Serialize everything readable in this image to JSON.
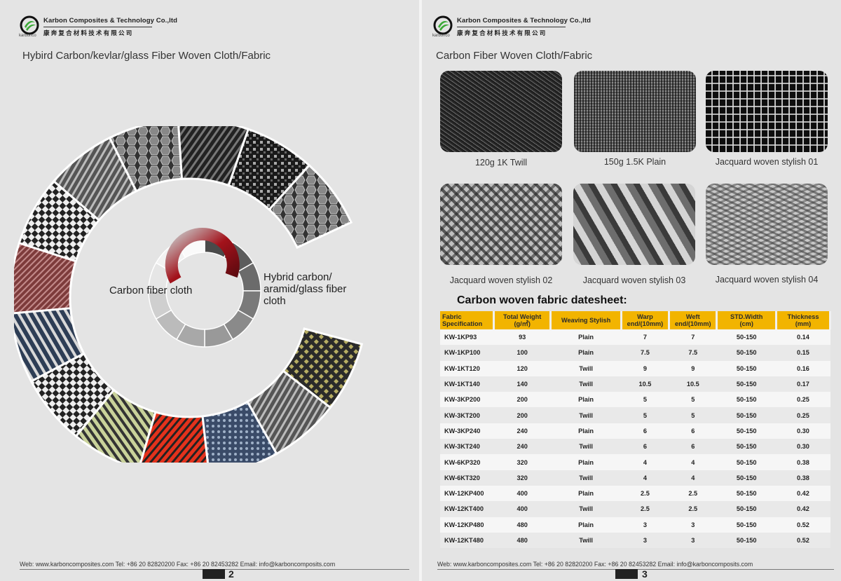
{
  "left": {
    "brand_en": "Karbon Composites & Technology Co.,ltd",
    "brand_cn": "康奔复合材料技术有限公司",
    "brand_sub": "karbonco",
    "title": "Hybird Carbon/kevlar/glass Fiber Woven Cloth/Fabric",
    "label_carbon": "Carbon fiber cloth",
    "label_hybrid": "Hybrid carbon/\naramid/glass fiber\ncloth",
    "footer": "Web: www.karboncomposites.com   Tel: +86 20 82820200  Fax: +86 20 82453282  Email: info@karboncomposits.com",
    "page_number": "2"
  },
  "right": {
    "brand_en": "Karbon Composites & Technology Co.,ltd",
    "brand_cn": "康奔复合材料技术有限公司",
    "brand_sub": "karbonco",
    "title": "Carbon Fiber Woven Cloth/Fabric",
    "photos": [
      {
        "caption": "120g 1K Twill",
        "icon": "twill-weave-photo"
      },
      {
        "caption": "150g 1.5K Plain",
        "icon": "plain-weave-photo"
      },
      {
        "caption": "Jacquard woven stylish 01",
        "icon": "jacquard-01-photo"
      },
      {
        "caption": "Jacquard woven stylish 02",
        "icon": "jacquard-02-photo"
      },
      {
        "caption": "Jacquard woven stylish 03",
        "icon": "jacquard-03-photo"
      },
      {
        "caption": "Jacquard woven stylish 04",
        "icon": "jacquard-04-photo"
      }
    ],
    "table_title": "Carbon woven fabric datesheet:",
    "table_headers": [
      "Fabric\nSpecification",
      "Total Weight\n(g/㎡)",
      "Weaving Stylish",
      "Warp\nend/(10mm)",
      "Weft\nend/(10mm)",
      "STD.Width\n(cm)",
      "Thickness\n(mm)"
    ],
    "table_rows": [
      [
        "KW-1KP93",
        "93",
        "Plain",
        "7",
        "7",
        "50-150",
        "0.14"
      ],
      [
        "KW-1KP100",
        "100",
        "Plain",
        "7.5",
        "7.5",
        "50-150",
        "0.15"
      ],
      [
        "KW-1KT120",
        "120",
        "Twill",
        "9",
        "9",
        "50-150",
        "0.16"
      ],
      [
        "KW-1KT140",
        "140",
        "Twill",
        "10.5",
        "10.5",
        "50-150",
        "0.17"
      ],
      [
        "KW-3KP200",
        "200",
        "Plain",
        "5",
        "5",
        "50-150",
        "0.25"
      ],
      [
        "KW-3KT200",
        "200",
        "Twill",
        "5",
        "5",
        "50-150",
        "0.25"
      ],
      [
        "KW-3KP240",
        "240",
        "Plain",
        "6",
        "6",
        "50-150",
        "0.30"
      ],
      [
        "KW-3KT240",
        "240",
        "Twill",
        "6",
        "6",
        "50-150",
        "0.30"
      ],
      [
        "KW-6KP320",
        "320",
        "Plain",
        "4",
        "4",
        "50-150",
        "0.38"
      ],
      [
        "KW-6KT320",
        "320",
        "Twill",
        "4",
        "4",
        "50-150",
        "0.38"
      ],
      [
        "KW-12KP400",
        "400",
        "Plain",
        "2.5",
        "2.5",
        "50-150",
        "0.42"
      ],
      [
        "KW-12KT400",
        "400",
        "Twill",
        "2.5",
        "2.5",
        "50-150",
        "0.42"
      ],
      [
        "KW-12KP480",
        "480",
        "Plain",
        "3",
        "3",
        "50-150",
        "0.52"
      ],
      [
        "KW-12KT480",
        "480",
        "Twill",
        "3",
        "3",
        "50-150",
        "0.52"
      ]
    ],
    "footer": "Web: www.karboncomposites.com   Tel: +86 20 82820200  Fax: +86 20 82453282  Email: info@karboncomposits.com",
    "page_number": "3"
  },
  "colors": {
    "accent_green": "#3aa935",
    "table_header": "#f2b400",
    "ring_red": "#a3121b"
  }
}
